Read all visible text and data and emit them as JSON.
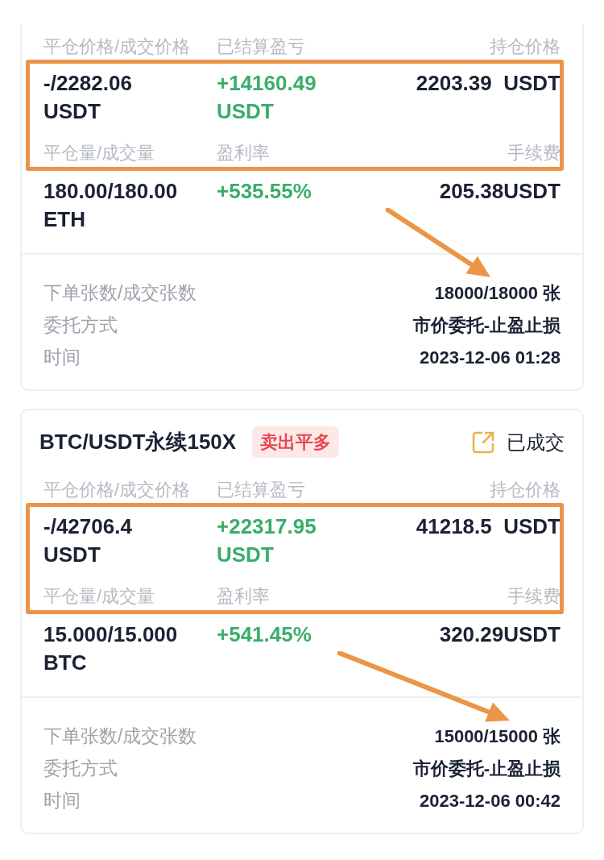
{
  "orders": [
    {
      "highlighted": true,
      "labels": [
        "平仓价格/成交价格",
        "已结算盈亏",
        "持仓价格"
      ],
      "values": [
        {
          "lines": [
            "-/2282.06",
            "USDT"
          ],
          "positive": false
        },
        {
          "lines": [
            "+14160.49",
            "USDT"
          ],
          "positive": true
        },
        {
          "lines": [
            "2203.39  USDT"
          ],
          "positive": false
        }
      ],
      "labels2": [
        "平仓量/成交量",
        "盈利率",
        "手续费"
      ],
      "values2": [
        {
          "lines": [
            "180.00/180.00",
            "ETH"
          ],
          "positive": false
        },
        {
          "lines": [
            "+535.55%"
          ],
          "positive": true
        },
        {
          "lines": [
            "205.38USDT"
          ],
          "positive": false
        }
      ],
      "info": [
        {
          "label": "下单张数/成交张数",
          "value": "18000/18000 张"
        },
        {
          "label": "委托方式",
          "value": "市价委托-止盈止损"
        },
        {
          "label": "时间",
          "value": "2023-12-06 01:28"
        }
      ]
    },
    {
      "highlighted": true,
      "header": {
        "pair": "BTC/USDT永续150X",
        "tag": "卖出平多",
        "status": "已成交"
      },
      "labels": [
        "平仓价格/成交价格",
        "已结算盈亏",
        "持仓价格"
      ],
      "values": [
        {
          "lines": [
            "-/42706.4",
            "USDT"
          ],
          "positive": false
        },
        {
          "lines": [
            "+22317.95",
            "USDT"
          ],
          "positive": true
        },
        {
          "lines": [
            "41218.5  USDT"
          ],
          "positive": false
        }
      ],
      "labels2": [
        "平仓量/成交量",
        "盈利率",
        "手续费"
      ],
      "values2": [
        {
          "lines": [
            "15.000/15.000",
            "BTC"
          ],
          "positive": false
        },
        {
          "lines": [
            "+541.45%"
          ],
          "positive": true
        },
        {
          "lines": [
            "320.29USDT"
          ],
          "positive": false
        }
      ],
      "info": [
        {
          "label": "下单张数/成交张数",
          "value": "15000/15000 张"
        },
        {
          "label": "委托方式",
          "value": "市价委托-止盈止损"
        },
        {
          "label": "时间",
          "value": "2023-12-06 00:42"
        }
      ]
    }
  ]
}
